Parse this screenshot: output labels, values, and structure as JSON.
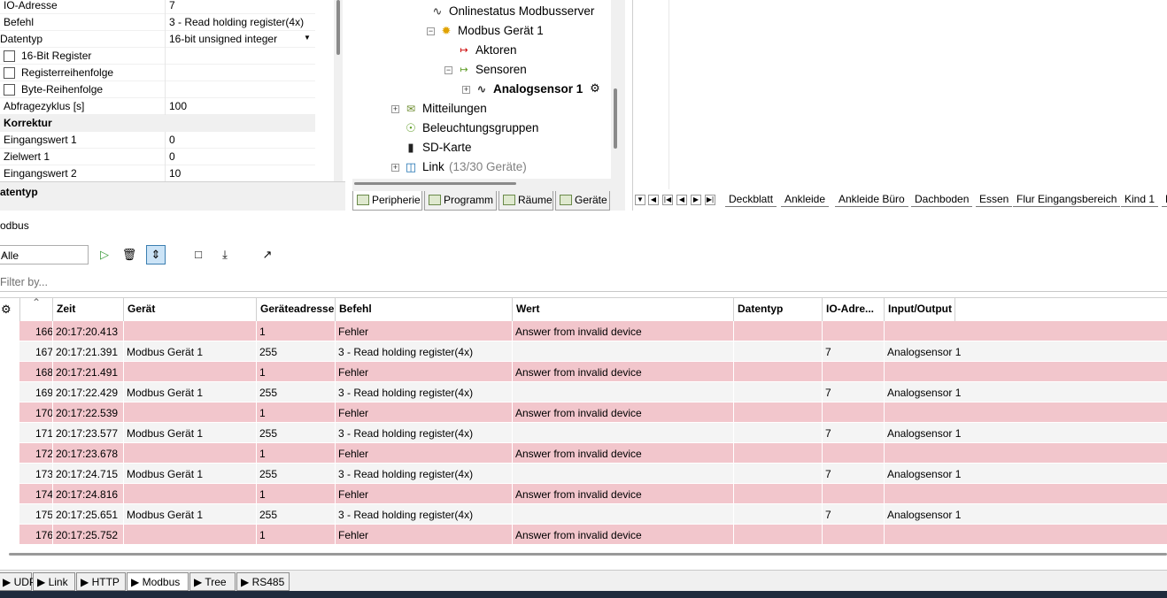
{
  "properties": {
    "rows": [
      {
        "key": "IO-Adresse",
        "value": "7"
      },
      {
        "key": "Befehl",
        "value": "3 - Read holding register(4x)"
      },
      {
        "key": "Datentyp",
        "value": "16-bit unsigned integer"
      },
      {
        "key": "16-Bit Register",
        "value": ""
      },
      {
        "key": "Registerreihenfolge",
        "value": ""
      },
      {
        "key": "Byte-Reihenfolge",
        "value": ""
      },
      {
        "key": "Abfragezyklus [s]",
        "value": "100"
      },
      {
        "key": "Korrektur",
        "value": ""
      },
      {
        "key": "Eingangswert 1",
        "value": "0"
      },
      {
        "key": "Zielwert 1",
        "value": "0"
      },
      {
        "key": "Eingangswert 2",
        "value": "10"
      }
    ],
    "description_title": "atentyp"
  },
  "tree": {
    "items": [
      {
        "label": "Onlinestatus Modbusserver"
      },
      {
        "label": "Modbus Gerät 1"
      },
      {
        "label": "Aktoren"
      },
      {
        "label": "Sensoren"
      },
      {
        "label": "Analogsensor 1"
      },
      {
        "label": "Mitteilungen"
      },
      {
        "label": "Beleuchtungsgruppen"
      },
      {
        "label": "SD-Karte"
      },
      {
        "label": "Link",
        "suffix": "(13/30 Geräte)"
      }
    ],
    "tabs": [
      "Peripherie",
      "Programm",
      "Räume",
      "Geräte"
    ]
  },
  "sheets": [
    "Deckblatt",
    "Ankleide",
    "Ankleide Büro",
    "Dachboden",
    "Essen",
    "Flur Eingangsbereich",
    "Kind 1",
    "K"
  ],
  "modbus": {
    "section_title": "odbus",
    "filter_select": "Alle",
    "filter_placeholder": "Filter by...",
    "columns": [
      "Zeit",
      "Gerät",
      "Geräteadresse",
      "Befehl",
      "Wert",
      "Datentyp",
      "IO-Adre...",
      "Input/Output"
    ],
    "rows": [
      {
        "id": "166",
        "time": "20:17:20.413",
        "device": "",
        "addr": "1",
        "cmd": "Fehler",
        "value": "Answer from invalid device",
        "type": "",
        "io": "",
        "inout": "",
        "status": "error"
      },
      {
        "id": "167",
        "time": "20:17:21.391",
        "device": "Modbus Gerät 1",
        "addr": "255",
        "cmd": "3 - Read holding register(4x)",
        "value": "",
        "type": "",
        "io": "7",
        "inout": "Analogsensor 1",
        "status": "ok"
      },
      {
        "id": "168",
        "time": "20:17:21.491",
        "device": "",
        "addr": "1",
        "cmd": "Fehler",
        "value": "Answer from invalid device",
        "type": "",
        "io": "",
        "inout": "",
        "status": "error"
      },
      {
        "id": "169",
        "time": "20:17:22.429",
        "device": "Modbus Gerät 1",
        "addr": "255",
        "cmd": "3 - Read holding register(4x)",
        "value": "",
        "type": "",
        "io": "7",
        "inout": "Analogsensor 1",
        "status": "ok"
      },
      {
        "id": "170",
        "time": "20:17:22.539",
        "device": "",
        "addr": "1",
        "cmd": "Fehler",
        "value": "Answer from invalid device",
        "type": "",
        "io": "",
        "inout": "",
        "status": "error"
      },
      {
        "id": "171",
        "time": "20:17:23.577",
        "device": "Modbus Gerät 1",
        "addr": "255",
        "cmd": "3 - Read holding register(4x)",
        "value": "",
        "type": "",
        "io": "7",
        "inout": "Analogsensor 1",
        "status": "ok"
      },
      {
        "id": "172",
        "time": "20:17:23.678",
        "device": "",
        "addr": "1",
        "cmd": "Fehler",
        "value": "Answer from invalid device",
        "type": "",
        "io": "",
        "inout": "",
        "status": "error"
      },
      {
        "id": "173",
        "time": "20:17:24.715",
        "device": "Modbus Gerät 1",
        "addr": "255",
        "cmd": "3 - Read holding register(4x)",
        "value": "",
        "type": "",
        "io": "7",
        "inout": "Analogsensor 1",
        "status": "ok"
      },
      {
        "id": "174",
        "time": "20:17:24.816",
        "device": "",
        "addr": "1",
        "cmd": "Fehler",
        "value": "Answer from invalid device",
        "type": "",
        "io": "",
        "inout": "",
        "status": "error"
      },
      {
        "id": "175",
        "time": "20:17:25.651",
        "device": "Modbus Gerät 1",
        "addr": "255",
        "cmd": "3 - Read holding register(4x)",
        "value": "",
        "type": "",
        "io": "7",
        "inout": "Analogsensor 1",
        "status": "ok"
      },
      {
        "id": "176",
        "time": "20:17:25.752",
        "device": "",
        "addr": "1",
        "cmd": "Fehler",
        "value": "Answer from invalid device",
        "type": "",
        "io": "",
        "inout": "",
        "status": "error"
      }
    ]
  },
  "bottom_tabs": [
    "UDP",
    "Link",
    "HTTP",
    "Modbus",
    "Tree",
    "RS485"
  ],
  "colors": {
    "error_row": "#f2c6cc",
    "ok_row": "#f4f4f4",
    "selected_button": "#cce4f7"
  }
}
